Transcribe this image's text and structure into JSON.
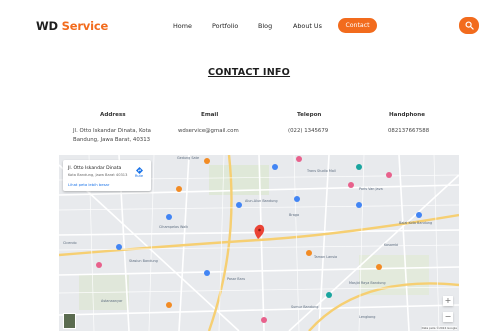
{
  "brand": {
    "part1": "WD",
    "part2": "Service",
    "accent_color": "#f26b1d"
  },
  "nav": {
    "items": [
      "Home",
      "Portfolio",
      "Blog",
      "About Us"
    ],
    "contact_label": "Contact",
    "search_icon": "search-icon"
  },
  "page": {
    "title": "CONTACT INFO"
  },
  "contact": {
    "columns": [
      {
        "heading": "Address",
        "value_lines": [
          "Jl. Otto Iskandar Dinata, Kota",
          "Bandung, Jawa Barat, 40313"
        ]
      },
      {
        "heading": "Email",
        "value_lines": [
          "wdservice@gmail.com"
        ]
      },
      {
        "heading": "Telepon",
        "value_lines": [
          "(022) 1345679"
        ]
      },
      {
        "heading": "Handphone",
        "value_lines": [
          "082137667588"
        ]
      }
    ]
  },
  "map": {
    "place_name": "Jl. Otto Iskandar Dinata",
    "place_address": "Kota Bandung, Jawa Barat 40313",
    "directions_label": "Rute",
    "larger_map_label": "Lihat peta lebih besar",
    "labels": [
      "Gedung Sate",
      "Trans Studio Mall",
      "Paris Van Java",
      "Alun-Alun Bandung",
      "Braga",
      "Cihampelas Walk",
      "Balai Kota Bandung",
      "Taman Lansia",
      "Stasiun Bandung",
      "Pasar Baru",
      "Masjid Raya Bandung",
      "Kosambi",
      "Cicendo",
      "Astanaanyar",
      "Sumur Bandung",
      "Lengkong"
    ],
    "zoom_in_label": "+",
    "zoom_out_label": "−",
    "attribution": "Data peta ©2024 Google"
  }
}
